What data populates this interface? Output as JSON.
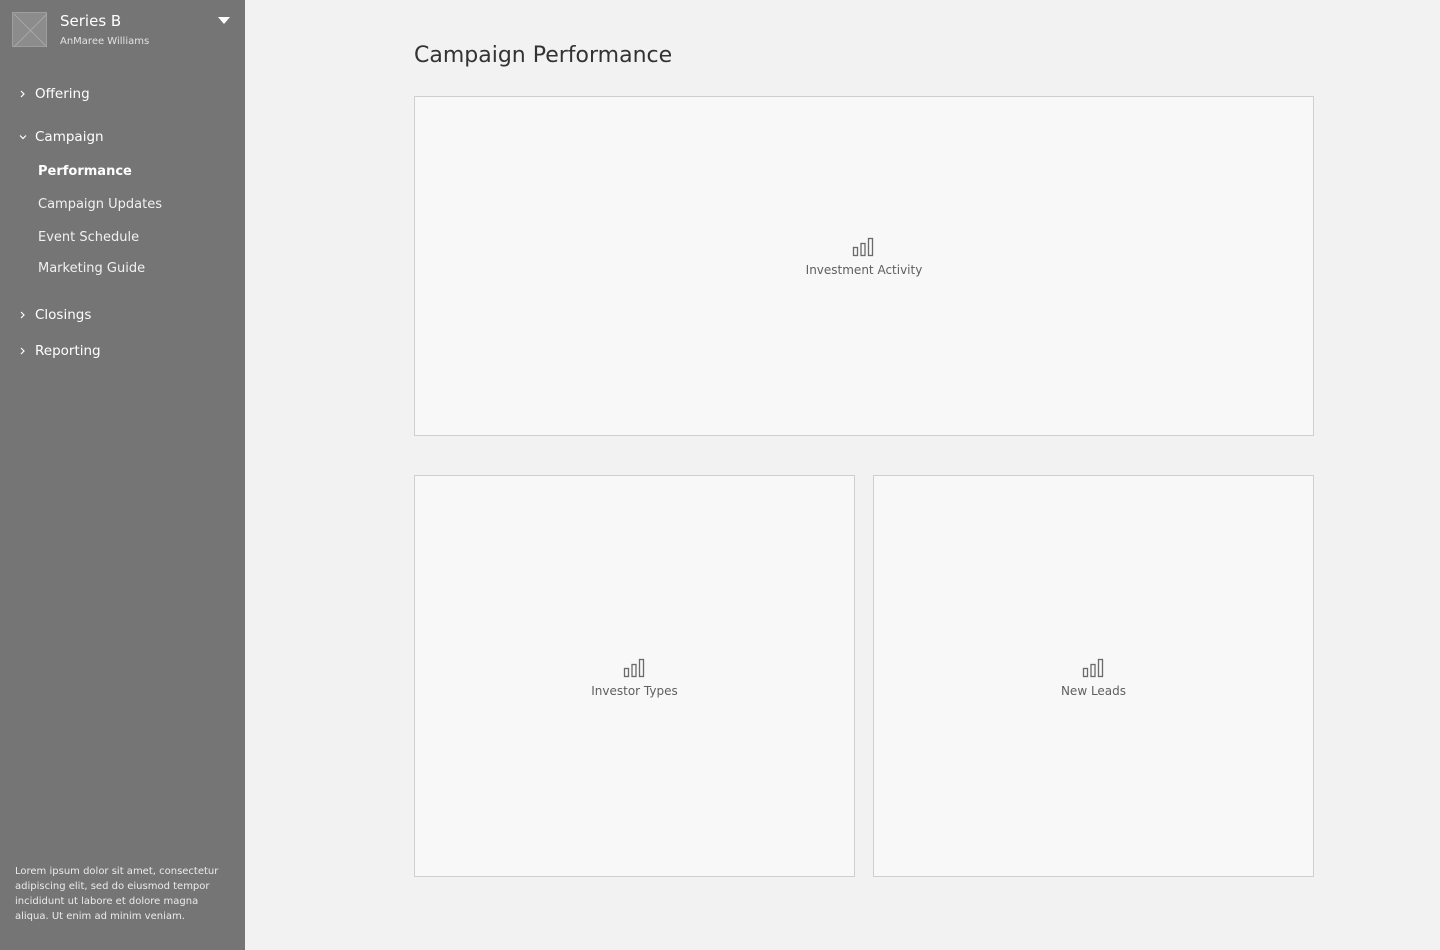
{
  "account": {
    "title": "Series B",
    "user": "AnMaree Williams"
  },
  "nav": {
    "offering": "Offering",
    "campaign": "Campaign",
    "campaign_items": [
      "Performance",
      "Campaign Updates",
      "Event Schedule",
      "Marketing Guide"
    ],
    "closings": "Closings",
    "reporting": "Reporting"
  },
  "footer_text": "Lorem ipsum dolor sit amet, consectetur adipiscing elit, sed do eiusmod tempor incididunt ut labore et dolore magna aliqua. Ut enim ad minim veniam.",
  "page_title": "Campaign Performance",
  "cards": [
    {
      "label": "Investment Activity",
      "icon": "bar-chart-icon"
    },
    {
      "label": "Investor Types",
      "icon": "bar-chart-icon"
    },
    {
      "label": "New Leads",
      "icon": "bar-chart-icon"
    }
  ],
  "colors": {
    "sidebar_bg": "#757575",
    "page_bg": "#f2f2f2",
    "card_bg": "#f8f8f8",
    "card_border": "#cfcfcf"
  }
}
